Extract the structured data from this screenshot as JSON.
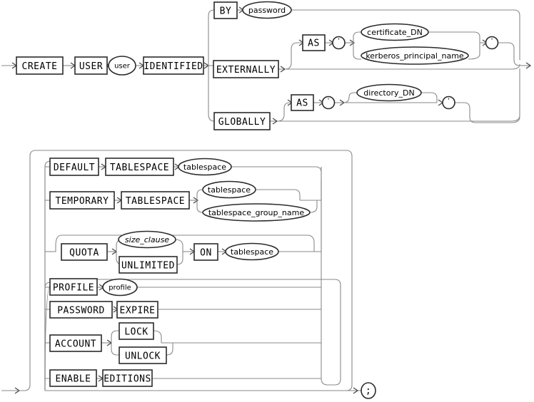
{
  "document": {
    "kind": "railroad-syntax-diagram",
    "title": "create_user",
    "background": "#ffffff",
    "line_color": "#8a8a8a",
    "box_stroke": "#2b2b2b",
    "text_color": "#000000"
  },
  "diagram_top": {
    "name": "create-user-statement",
    "keywords": {
      "create": "CREATE",
      "user": "USER",
      "identified": "IDENTIFIED",
      "by": "BY",
      "externally": "EXTERNALLY",
      "globally": "GLOBALLY",
      "as_1": "AS",
      "as_2": "AS"
    },
    "nonterminals": {
      "user": "user",
      "password": "password",
      "certificate_dn": "certificate_DN",
      "kerberos_principal_name": "kerberos_principal_name",
      "directory_dn": "directory_DN"
    },
    "literals": {
      "quote_open_1": "'",
      "quote_close_1": "'",
      "quote_open_2": "'",
      "quote_close_2": "'"
    }
  },
  "diagram_bottom": {
    "name": "create-user-options",
    "keywords": {
      "default": "DEFAULT",
      "tablespace_kw_1": "TABLESPACE",
      "temporary": "TEMPORARY",
      "tablespace_kw_2": "TABLESPACE",
      "quota": "QUOTA",
      "unlimited": "UNLIMITED",
      "on": "ON",
      "profile": "PROFILE",
      "password": "PASSWORD",
      "expire": "EXPIRE",
      "account": "ACCOUNT",
      "lock": "LOCK",
      "unlock": "UNLOCK",
      "enable": "ENABLE",
      "editions": "EDITIONS"
    },
    "nonterminals": {
      "tablespace_1": "tablespace",
      "tablespace_2": "tablespace",
      "tablespace_group_name": "tablespace_group_name",
      "size_clause": "size_clause",
      "tablespace_3": "tablespace",
      "profile": "profile"
    },
    "literals": {
      "semicolon": ";"
    }
  }
}
